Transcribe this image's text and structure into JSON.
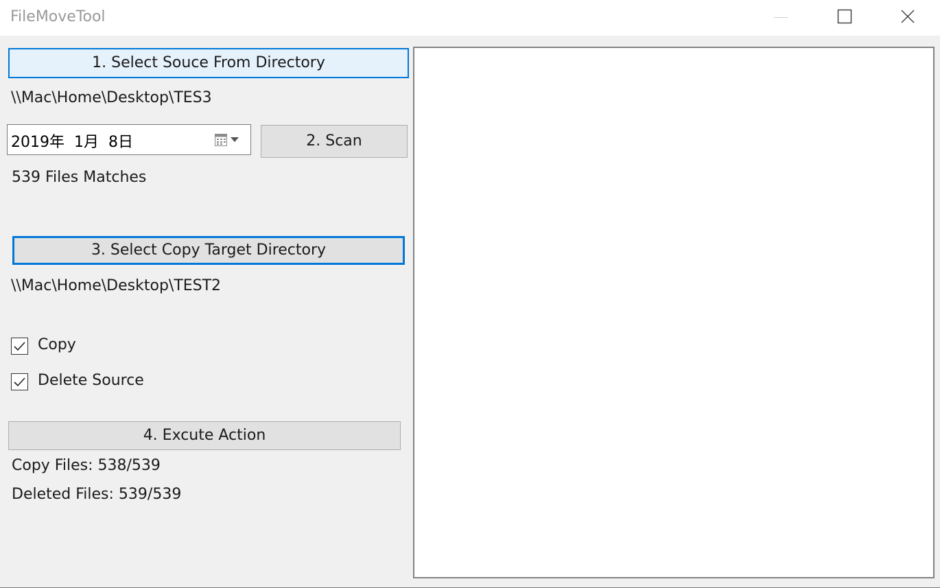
{
  "window": {
    "title": "FileMoveTool"
  },
  "source": {
    "button_label": "1. Select Souce From Directory",
    "path": "\\\\Mac\\Home\\Desktop\\TES3"
  },
  "date": {
    "value": "2019年  1月  8日",
    "icon": "calendar-icon"
  },
  "scan": {
    "button_label": "2. Scan",
    "result": "539 Files Matches"
  },
  "target": {
    "button_label": "3. Select Copy Target Directory",
    "path": "\\\\Mac\\Home\\Desktop\\TEST2"
  },
  "options": {
    "copy": {
      "label": "Copy",
      "checked": true
    },
    "delete_source": {
      "label": "Delete Source",
      "checked": true
    }
  },
  "action": {
    "button_label": "4. Excute Action",
    "copy_status": "Copy Files: 538/539",
    "delete_status": "Deleted Files: 539/539"
  },
  "colors": {
    "accent": "#0078d7",
    "window_bg": "#f0f0f0",
    "button_bg": "#e1e1e1",
    "hover_bg": "#e5f1fb"
  }
}
